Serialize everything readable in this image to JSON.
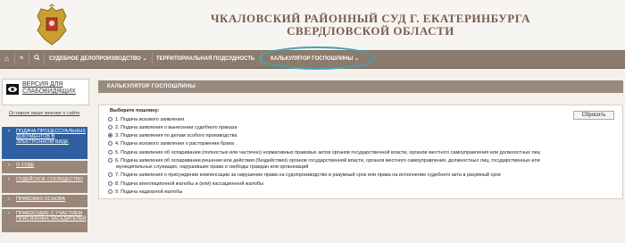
{
  "header": {
    "title_line1": "ЧКАЛОВСКИЙ РАЙОННЫЙ СУД Г. ЕКАТЕРИНБУРГА",
    "title_line2": "СВЕРДЛОВСКОЙ ОБЛАСТИ",
    "emblem_icon": "coat-of-arms-icon"
  },
  "nav": {
    "home_icon": "home-icon",
    "map_icon": "sitemap-icon",
    "search_icon": "search-icon",
    "items": [
      {
        "label": "СУДЕБНОЕ ДЕЛОПРОИЗВОДСТВО ⌄"
      },
      {
        "label": "ТЕРРИТОРИАЛЬНАЯ ПОДСУДНОСТЬ"
      },
      {
        "label": "КАЛЬКУЛЯТОР ГОСПОШЛИНЫ ⌄"
      }
    ],
    "highlight_color": "#3fa3b8"
  },
  "sidebar": {
    "a11y_label": "ВЕРСИЯ ДЛЯ СЛАБОВИДЯЩИХ",
    "feedback_label": "Оставьте ваше мнение о сайте",
    "items": [
      {
        "label": "ПОДАЧА ПРОЦЕССУАЛЬНЫХ ДОКУМЕНТОВ В ЭЛЕКТРОННОМ ВИДЕ",
        "active": true
      },
      {
        "label": "О СУДЕ"
      },
      {
        "label": "СУДЕЙСКОЕ СООБЩЕСТВО"
      },
      {
        "label": "ПРАВОВАЯ ОСНОВА"
      },
      {
        "label": "ПРАВОСУДИЕ С УЧАСТИЕМ ПРИСЯЖНЫХ ЗАСЕДАТЕЛЕЙ"
      }
    ],
    "active_color": "#2f5fa0"
  },
  "main": {
    "panel_title": "КАЛЬКУЛЯТОР ГОСПОШЛИНЫ",
    "legend": "Выберите пошлину:",
    "reset_label": "Сбросить",
    "selected_index": 2,
    "options": [
      "1. Подача искового заявления",
      "2. Подача заявления о вынесении судебного приказа",
      "3. Подача заявления по делам особого производства",
      "4. Подача искового заявления о расторжении брака",
      "5. Подача заявления об оспаривании (полностью или частично) нормативных правовых актов органов государственной власти, органов местного самоуправления или должностных лиц",
      "6. Подача заявления об оспаривании решения или действия (бездействия) органов государственной власти, органов местного самоуправления, должностных лиц, государственных или",
      "муниципальных служащих, нарушивших права и свободы граждан или организаций",
      "7. Подача заявления о присуждении компенсации за нарушение права на судопроизводство в разумный срок или права на исполнение судебного акта в разумный срок",
      "8. Подача апелляционной жалобы и (или) кассационной жалобы",
      "9. Подача надзорной жалобы"
    ]
  }
}
